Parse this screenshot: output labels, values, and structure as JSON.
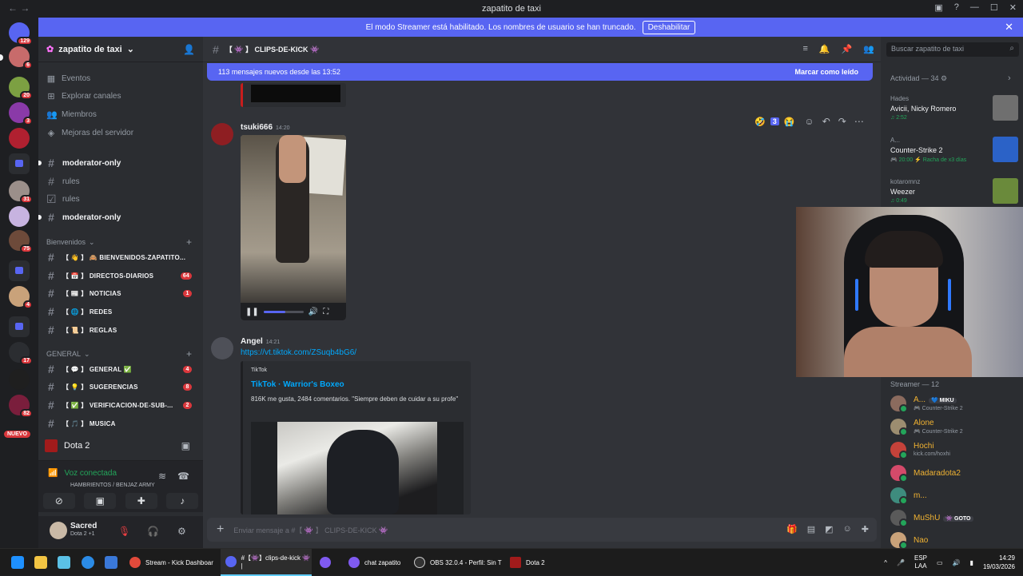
{
  "window": {
    "title": "zapatito de taxi",
    "nav": "←  →"
  },
  "banner": {
    "text": "El modo Streamer está habilitado. Los nombres de usuario se han truncado.",
    "button": "Deshabilitar"
  },
  "guilds": {
    "badges": [
      "129",
      "6",
      "20",
      "3",
      "31",
      "75",
      "4",
      "17",
      "82"
    ],
    "nuevo": "NUEVO"
  },
  "server": {
    "name": "zapatito de taxi"
  },
  "sidebar": {
    "items": [
      "Eventos",
      "Explorar canales",
      "Miembros",
      "Mejoras del servidor"
    ],
    "channels_top": [
      "moderator-only",
      "rules",
      "rules",
      "moderator-only"
    ],
    "cat1": "Bienvenidos",
    "cat1_channels": [
      {
        "name": "【 👋 】 🙈 BIENVENIDOS-ZAPATITO...",
        "count": ""
      },
      {
        "name": "【 📅 】 DIRECTOS-DIARIOS",
        "count": "64"
      },
      {
        "name": "【 📰 】 NOTICIAS",
        "count": "1"
      },
      {
        "name": "【 🌐 】 REDES",
        "count": ""
      },
      {
        "name": "【 📜 】 REGLAS",
        "count": ""
      }
    ],
    "cat2": "GENERAL",
    "cat2_channels": [
      {
        "name": "【 💬 】 GENERAL ✅",
        "count": "4"
      },
      {
        "name": "【 💡 】 SUGERENCIAS",
        "count": "8"
      },
      {
        "name": "【 ✅ 】 VERIFICACION-DE-SUB-...",
        "count": "2"
      },
      {
        "name": "【 🎵 】 MUSICA",
        "count": ""
      }
    ]
  },
  "game": {
    "name": "Dota 2"
  },
  "voice": {
    "status": "Voz conectada",
    "channel": "HAMBRIENTOS / BENJAZ ARMY"
  },
  "user": {
    "name": "Sacred",
    "status": "Dota 2 +1"
  },
  "channel": {
    "name": "【 👾 】 CLIPS-DE-KICK 👾"
  },
  "newbar": {
    "text": "113 mensajes nuevos desde las 13:52",
    "mark": "Marcar como leído"
  },
  "messages": [
    {
      "author": "tsuki666",
      "time": "14:20",
      "reaction_count": "3"
    },
    {
      "author": "Angel",
      "time": "14:21",
      "link": "https://vt.tiktok.com/ZSuqb4bG6/",
      "embed": {
        "provider": "TikTok",
        "title": "TikTok · Warrior's Boxeo",
        "desc": "816K me gusta, 2484 comentarios. \"Siempre deben de cuidar a su profe\""
      }
    }
  ],
  "video": {
    "progress": 0.55
  },
  "composer": {
    "placeholder": "Enviar mensaje a #【 👾 】 CLIPS-DE-KICK 👾"
  },
  "right": {
    "search": "Buscar zapatito de taxi",
    "activity_header": "Actividad — 34",
    "activities": [
      {
        "name": "Hades",
        "game": "Avicii, Nicky Romero",
        "time": "♫ 2:52",
        "art": "#7a7a7a"
      },
      {
        "name": "A...",
        "game": "Counter-Strike 2",
        "time": "🎮 20:00  ⚡ Racha de x3 días",
        "art": "#2b62c7"
      },
      {
        "name": "kotaromnz",
        "game": "Weezer",
        "time": "♫ 0:49",
        "art": "#6a8a3b"
      }
    ],
    "streamer_header": "Streamer — 12",
    "members": [
      {
        "name": "A...",
        "tag": "💙 MIKU",
        "sub": "🎮 Counter-Strike 2",
        "av": "#8b6b5e"
      },
      {
        "name": "Alone",
        "tag": "",
        "sub": "🎮 Counter-Strike 2",
        "av": "#9c8d70"
      },
      {
        "name": "Hochi",
        "tag": "",
        "sub": "kick.com/hoxhi",
        "av": "#c4423a"
      },
      {
        "name": "Madaradota2",
        "tag": "",
        "sub": "",
        "av": "#d44a6a"
      },
      {
        "name": "m...",
        "tag": "",
        "sub": "",
        "av": "#3e8c7e"
      },
      {
        "name": "MuShU",
        "tag": "👾 GOTO",
        "sub": "",
        "av": "#5a5a5a"
      },
      {
        "name": "Nao",
        "tag": "",
        "sub": "",
        "av": "#c9a27a"
      }
    ]
  },
  "taskbar": {
    "apps": [
      {
        "label": "Stream - Kick Dashboar",
        "color": "#e24a3b"
      },
      {
        "label": "#【👾】clips-de-kick 👾 |",
        "color": "#5865f2"
      },
      {
        "label": "",
        "color": "#7f5af0"
      },
      {
        "label": "chat zapatito",
        "color": "#7f5af0"
      },
      {
        "label": "OBS 32.0.4 - Perfil: Sin T",
        "color": "#333333"
      },
      {
        "label": "Dota 2",
        "color": "#a11b1b"
      }
    ],
    "lang1": "ESP",
    "lang2": "LAA",
    "time": "14:29",
    "date": "19/03/2026"
  }
}
